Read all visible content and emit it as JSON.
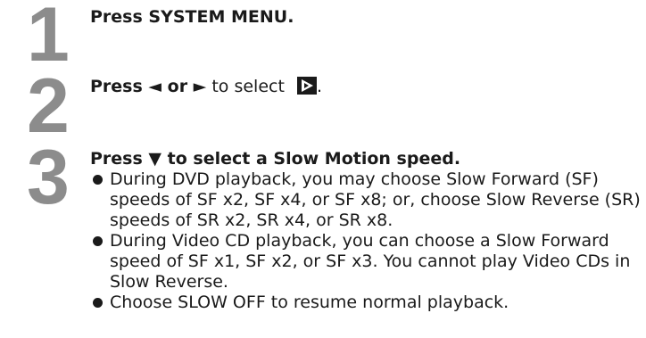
{
  "steps": [
    {
      "number": "1",
      "title_bold": "Press SYSTEM MENU."
    },
    {
      "number": "2",
      "title_bold": "Press ◄ or ►",
      "title_normal": " to select ",
      "title_end": ".",
      "icon": "slow-motion-play-icon"
    },
    {
      "number": "3",
      "title_bold": "Press ▼ to select a Slow Motion speed.",
      "bullets": [
        "During DVD playback, you may choose Slow Forward (SF) speeds of SF x2, SF x4, or SF x8; or, choose Slow Reverse (SR) speeds of SR x2, SR x4, or SR x8.",
        "During Video CD playback, you can choose a Slow Forward speed of SF x1, SF x2, or SF x3. You cannot play Video CDs in Slow Reverse.",
        "Choose SLOW OFF to resume normal playback."
      ]
    }
  ],
  "colors": {
    "step_number": "#8c8c8c",
    "text": "#1a1a1a"
  }
}
